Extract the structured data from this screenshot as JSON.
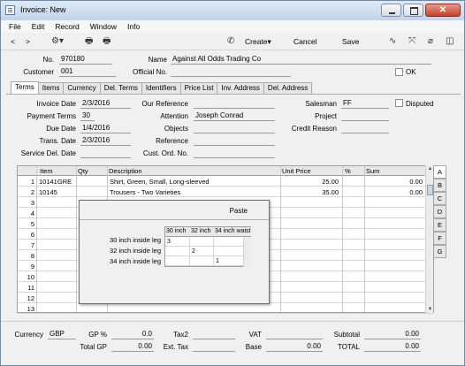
{
  "window": {
    "title": "Invoice: New"
  },
  "menu": [
    "File",
    "Edit",
    "Record",
    "Window",
    "Info"
  ],
  "toolbar": {
    "back": "<",
    "forward": ">",
    "create_label": "Create",
    "cancel_label": "Cancel",
    "save_label": "Save"
  },
  "header": {
    "no_label": "No.",
    "no_value": "970180",
    "name_label": "Name",
    "name_value": "Against All Odds Trading Co",
    "customer_label": "Customer",
    "customer_value": "001",
    "official_label": "Official No.",
    "official_value": "",
    "ok_label": "OK"
  },
  "tabs": [
    "Terms",
    "Items",
    "Currency",
    "Del. Terms",
    "Identifiers",
    "Price List",
    "Inv. Address",
    "Del. Address"
  ],
  "terms": {
    "invoice_date_label": "Invoice Date",
    "invoice_date": "2/3/2016",
    "payment_terms_label": "Payment Terms",
    "payment_terms": "30",
    "due_date_label": "Due Date",
    "due_date": "1/4/2016",
    "trans_date_label": "Trans. Date",
    "trans_date": "2/3/2016",
    "service_del_date_label": "Service Del. Date",
    "service_del_date": "",
    "our_reference_label": "Our Reference",
    "our_reference": "",
    "attention_label": "Attention",
    "attention": "Joseph Conrad",
    "objects_label": "Objects",
    "objects": "",
    "reference_label": "Reference",
    "reference": "",
    "cust_ord_label": "Cust. Ord. No.",
    "cust_ord": "",
    "salesman_label": "Salesman",
    "salesman": "FF",
    "project_label": "Project",
    "project": "",
    "credit_reason_label": "Credit Reason",
    "credit_reason": "",
    "disputed_label": "Disputed"
  },
  "grid": {
    "columns": [
      "Item",
      "Qty",
      "Description",
      "Unit Price",
      "%",
      "Sum"
    ],
    "rows": [
      {
        "n": "1",
        "item": "10141GRE",
        "qty": "",
        "desc": "Shirt, Green, Small, Long-sleeved",
        "price": "25.00",
        "pct": "",
        "sum": "0.00"
      },
      {
        "n": "2",
        "item": "10145",
        "qty": "",
        "desc": "Trousers - Two Varieties",
        "price": "35.00",
        "pct": "",
        "sum": "0.00"
      },
      {
        "n": "3"
      },
      {
        "n": "4"
      },
      {
        "n": "5"
      },
      {
        "n": "6"
      },
      {
        "n": "7"
      },
      {
        "n": "8"
      },
      {
        "n": "9"
      },
      {
        "n": "10"
      },
      {
        "n": "11"
      },
      {
        "n": "12"
      },
      {
        "n": "13"
      }
    ],
    "side_tabs": [
      "A",
      "B",
      "C",
      "D",
      "E",
      "F",
      "G"
    ]
  },
  "paste": {
    "title": "Paste",
    "columns": [
      "30 inch",
      "32 inch",
      "34 inch waist"
    ],
    "rows": [
      {
        "label": "30 inch inside leg",
        "values": [
          "3",
          "",
          ""
        ]
      },
      {
        "label": "32 inch inside leg",
        "values": [
          "",
          "2",
          ""
        ]
      },
      {
        "label": "34 inch inside leg",
        "values": [
          "",
          "",
          "1"
        ]
      }
    ]
  },
  "footer": {
    "currency_label": "Currency",
    "currency": "GBP",
    "gp_pct_label": "GP %",
    "gp_pct": "0.0",
    "total_gp_label": "Total GP",
    "total_gp": "0.00",
    "tax2_label": "Tax2",
    "tax2": "",
    "ext_tax_label": "Ext. Tax",
    "ext_tax": "",
    "vat_label": "VAT",
    "vat": "",
    "base_label": "Base",
    "base": "0.00",
    "subtotal_label": "Subtotal",
    "subtotal": "0.00",
    "total_label": "TOTAL",
    "total": "0.00"
  }
}
